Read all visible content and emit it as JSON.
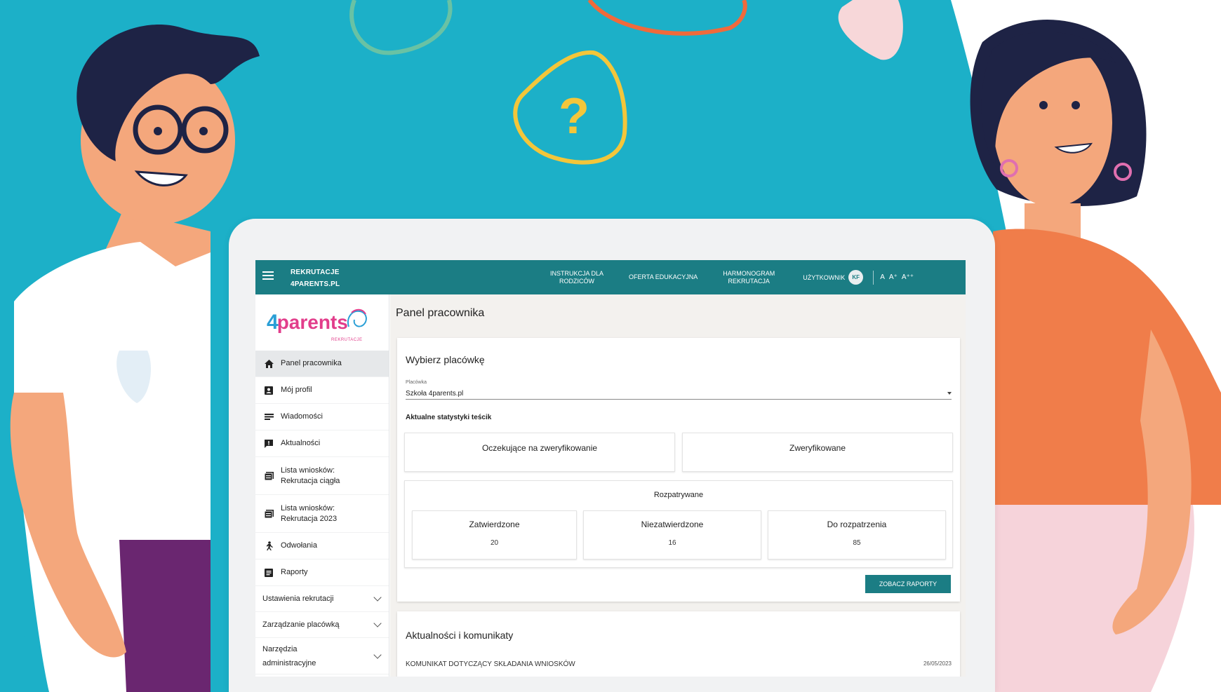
{
  "topbar": {
    "brand_line1": "REKRUTACJE",
    "brand_line2": "4PARENTS.PL",
    "nav": [
      {
        "line1": "INSTRUKCJA DLA",
        "line2": "RODZICÓW"
      },
      {
        "line1": "OFERTA EDUKACYJNA",
        "line2": ""
      },
      {
        "line1": "HARMONOGRAM",
        "line2": "REKRUTACJA"
      }
    ],
    "user_label": "UŻYTKOWNIK",
    "user_initials": "KF",
    "font_small": "A",
    "font_medium": "A⁺",
    "font_large": "A⁺⁺"
  },
  "logo": {
    "prefix": "4",
    "text": "parents",
    "sub": "REKRUTACJE"
  },
  "sidebar": {
    "items": [
      {
        "label": "Panel pracownika",
        "icon": "home-icon"
      },
      {
        "label": "Mój profil",
        "icon": "profile-icon"
      },
      {
        "label": "Wiadomości",
        "icon": "messages-icon"
      },
      {
        "label": "Aktualności",
        "icon": "news-icon"
      },
      {
        "label": "Lista wniosków: Rekrutacja ciągła",
        "icon": "list-icon"
      },
      {
        "label": "Lista wniosków: Rekrutacja 2023",
        "icon": "list-icon"
      },
      {
        "label": "Odwołania",
        "icon": "appeal-icon"
      },
      {
        "label": "Raporty",
        "icon": "reports-icon"
      }
    ],
    "groups": [
      {
        "label": "Ustawienia rekrutacji"
      },
      {
        "label": "Zarządzanie placówką"
      },
      {
        "label": "Narzędzia administracyjne"
      }
    ]
  },
  "main": {
    "page_title": "Panel pracownika",
    "facility_card": {
      "title": "Wybierz placówkę",
      "select_label": "Placówka",
      "select_value": "Szkoła 4parents.pl",
      "stats_label": "Aktualne statystyki teścik",
      "pending_title": "Oczekujące na zweryfikowanie",
      "verified_title": "Zweryfikowane",
      "reviewed_title": "Rozpatrywane",
      "approved_title": "Zatwierdzone",
      "approved_value": "20",
      "rejected_title": "Niezatwierdzone",
      "rejected_value": "16",
      "to_review_title": "Do rozpatrzenia",
      "to_review_value": "85",
      "reports_button": "ZOBACZ RAPORTY"
    },
    "news_card": {
      "title": "Aktualności i komunikaty",
      "items": [
        {
          "title": "KOMUNIKAT DOTYCZĄCY SKŁADANIA WNIOSKÓW",
          "date": "26/05/2023"
        }
      ]
    }
  },
  "decor": {
    "question_mark": "?",
    "colors": {
      "teal_bg": "#1cb0c8",
      "frame": "#f1f2f3",
      "topbar": "#1b7d84",
      "man_shirt": "#ffffff",
      "man_pants": "#6a2670",
      "woman_top": "#f07d4a",
      "skin": "#f4a77c",
      "hair": "#1e2345"
    }
  }
}
